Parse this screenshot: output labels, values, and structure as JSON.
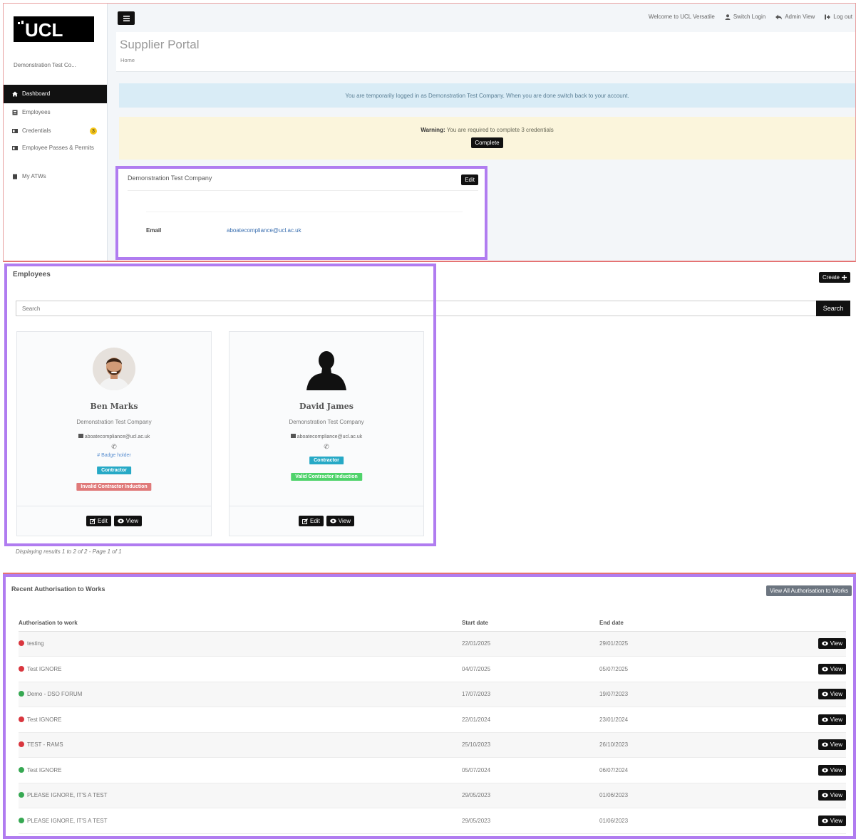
{
  "brand": {
    "logo_text": "UCL",
    "company_short": "Demonstration Test Co..."
  },
  "sidebar": {
    "items": [
      {
        "label": "Dashboard",
        "icon": "home-icon",
        "active": true
      },
      {
        "label": "Employees",
        "icon": "users-icon"
      },
      {
        "label": "Credentials",
        "icon": "id-card-icon",
        "badge": "3"
      },
      {
        "label": "Employee Passes & Permits",
        "icon": "pass-icon"
      },
      {
        "label": "My ATWs",
        "icon": "file-icon"
      }
    ]
  },
  "topnav": {
    "welcome": "Welcome to UCL Versatile",
    "switch_login": "Switch Login",
    "admin_view": "Admin View",
    "log_out": "Log out"
  },
  "header": {
    "title": "Supplier Portal",
    "breadcrumb": "Home"
  },
  "alerts": {
    "info": "You are temporarily logged in as Demonstration Test Company. When you are done switch back to your account.",
    "warning_label": "Warning:",
    "warning_text": "You are required to complete 3 credentials",
    "complete_button": "Complete"
  },
  "company_card": {
    "title": "Demonstration Test Company",
    "edit_button": "Edit",
    "email_label": "Email",
    "email_value": "aboatecompliance@ucl.ac.uk"
  },
  "employees": {
    "title": "Employees",
    "create_button": "Create",
    "search_placeholder": "Search",
    "search_button": "Search",
    "cards": [
      {
        "name": "Ben Marks",
        "company": "Demonstration Test Company",
        "email": "aboatecompliance@ucl.ac.uk",
        "badge_text": "# Badge holder",
        "role_tag": "Contractor",
        "status_tag": "Invalid Contractor Induction",
        "edit_label": "Edit",
        "view_label": "View"
      },
      {
        "name": "David James",
        "company": "Demonstration Test Company",
        "email": "aboatecompliance@ucl.ac.uk",
        "role_tag": "Contractor",
        "status_tag": "Valid Contractor Induction",
        "edit_label": "Edit",
        "view_label": "View"
      }
    ],
    "results_text": "Displaying results 1 to 2 of 2 - Page 1 of 1"
  },
  "atw": {
    "title": "Recent Authorisation to Works",
    "view_all_button": "View All Authorisation to Works",
    "columns": [
      "Authorisation to work",
      "Start date",
      "End date"
    ],
    "view_label": "View",
    "status_colors": {
      "red": "#d9363e",
      "green": "#36a852"
    },
    "rows": [
      {
        "status": "red",
        "name": "testing",
        "start": "22/01/2025",
        "end": "29/01/2025"
      },
      {
        "status": "red",
        "name": "Test IGNORE",
        "start": "04/07/2025",
        "end": "05/07/2025"
      },
      {
        "status": "green",
        "name": "Demo - DSO FORUM",
        "start": "17/07/2023",
        "end": "19/07/2023"
      },
      {
        "status": "red",
        "name": "Test IGNORE",
        "start": "22/01/2024",
        "end": "23/01/2024"
      },
      {
        "status": "red",
        "name": "TEST - RAMS",
        "start": "25/10/2023",
        "end": "26/10/2023"
      },
      {
        "status": "green",
        "name": "Test IGNORE",
        "start": "05/07/2024",
        "end": "06/07/2024"
      },
      {
        "status": "green",
        "name": "PLEASE IGNORE, IT'S A TEST",
        "start": "29/05/2023",
        "end": "01/06/2023"
      },
      {
        "status": "green",
        "name": "PLEASE IGNORE, IT'S A TEST",
        "start": "29/05/2023",
        "end": "01/06/2023"
      }
    ]
  }
}
